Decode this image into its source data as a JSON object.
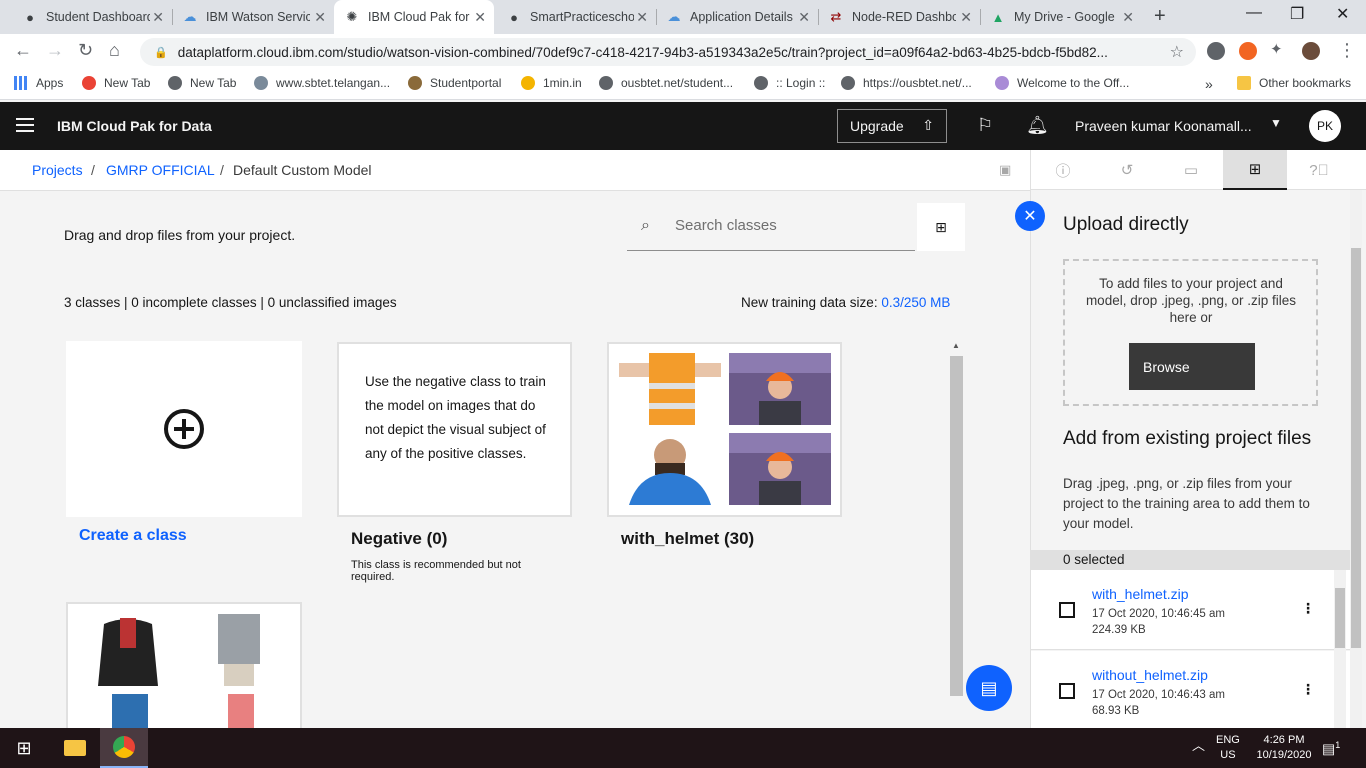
{
  "browser": {
    "tabs": [
      {
        "label": "Student Dashboard",
        "icon": "github-icon"
      },
      {
        "label": "IBM Watson Services",
        "icon": "cloud-icon"
      },
      {
        "label": "IBM Cloud Pak for Data",
        "icon": "ibm-bee-icon",
        "active": true
      },
      {
        "label": "SmartPracticeschool",
        "icon": "github-icon"
      },
      {
        "label": "Application Details",
        "icon": "cloud-icon"
      },
      {
        "label": "Node-RED Dashboard",
        "icon": "node-red-icon"
      },
      {
        "label": "My Drive - Google Drive",
        "icon": "drive-icon"
      }
    ],
    "url": "dataplatform.cloud.ibm.com/studio/watson-vision-combined/70def9c7-c418-4217-94b3-a519343a2e5c/train?project_id=a09f64a2-bd63-4b25-bdcb-f5bd82...",
    "bookmarks": [
      {
        "label": "Apps"
      },
      {
        "label": "New Tab"
      },
      {
        "label": "New Tab"
      },
      {
        "label": "www.sbtet.telangan..."
      },
      {
        "label": "Studentportal"
      },
      {
        "label": "1min.in"
      },
      {
        "label": "ousbtet.net/student..."
      },
      {
        "label": ":: Login ::"
      },
      {
        "label": "https://ousbtet.net/..."
      },
      {
        "label": "Welcome to the Off..."
      },
      {
        "label": "»"
      },
      {
        "label": "Other bookmarks"
      }
    ]
  },
  "header": {
    "brand": "IBM Cloud Pak for Data",
    "upgrade_label": "Upgrade",
    "user_name": "Praveen kumar Koonamall...",
    "avatar_initials": "PK"
  },
  "breadcrumb": {
    "projects": "Projects",
    "sep1": "/",
    "project": "GMRP OFFICIAL",
    "sep2": "/",
    "model": "Default Custom Model"
  },
  "main": {
    "drag_text": "Drag and drop files from your project.",
    "search_placeholder": "Search classes",
    "stats": "3 classes | 0 incomplete classes | 0 unclassified images",
    "training_size_label": "New training data size: ",
    "training_size_value": "0.3/250 MB",
    "create_class": "Create a class",
    "negative": {
      "description": "Use the negative class to train the model on images that do not depict the visual subject of any of the positive classes.",
      "title": "Negative (0)",
      "note": "This class is recommended but not required."
    },
    "with_helmet_title": "with_helmet (30)"
  },
  "panel": {
    "upload_title": "Upload directly",
    "drop_text": "To add files to your project and model, drop .jpeg, .png, or .zip files here or",
    "browse": "Browse",
    "existing_title": "Add from existing project files",
    "existing_desc": "Drag .jpeg, .png, or .zip files from your project to the training area to add them to your model.",
    "selected": "0 selected",
    "files": [
      {
        "name": "with_helmet.zip",
        "date": "17 Oct 2020, 10:46:45 am",
        "size": "224.39 KB"
      },
      {
        "name": "without_helmet.zip",
        "date": "17 Oct 2020, 10:46:43 am",
        "size": "68.93 KB"
      }
    ]
  },
  "taskbar": {
    "lang1": "ENG",
    "lang2": "US",
    "time": "4:26 PM",
    "date": "10/19/2020",
    "notif_count": "1"
  }
}
